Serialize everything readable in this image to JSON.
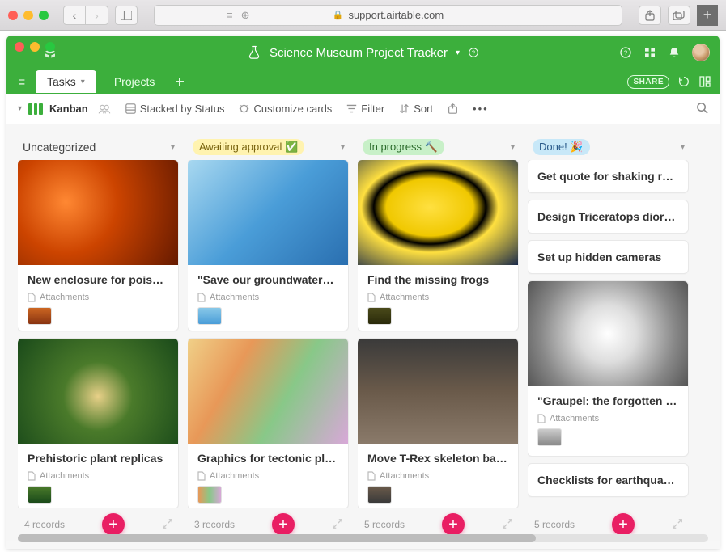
{
  "browser": {
    "url": "support.airtable.com"
  },
  "base": {
    "title": "Science Museum Project Tracker"
  },
  "tabs": {
    "active": "Tasks",
    "others": [
      "Projects"
    ]
  },
  "view": {
    "name": "Kanban",
    "stacked_by": "Stacked by Status",
    "customize": "Customize cards",
    "filter": "Filter",
    "sort": "Sort"
  },
  "share_label": "SHARE",
  "columns": [
    {
      "title": "Uncategorized",
      "pill": false,
      "footer_count": "4 records",
      "cards": [
        {
          "kind": "img",
          "img": "img-frog",
          "title": "New enclosure for poiso…",
          "attach_label": "Attachments",
          "thumb": "thumb-frog"
        },
        {
          "kind": "img",
          "img": "img-plant",
          "title": "Prehistoric plant replicas",
          "attach_label": "Attachments",
          "thumb": "thumb-plant"
        }
      ]
    },
    {
      "title": "Awaiting approval ✅",
      "pill": true,
      "pill_bg": "#fff3b0",
      "pill_fg": "#7a6510",
      "footer_count": "3 records",
      "cards": [
        {
          "kind": "img",
          "img": "img-water",
          "title": "\"Save our groundwater\" …",
          "attach_label": "Attachments",
          "thumb": "thumb-water"
        },
        {
          "kind": "img",
          "img": "img-plates",
          "title": "Graphics for tectonic pla…",
          "attach_label": "Attachments",
          "thumb": "thumb-plates"
        }
      ]
    },
    {
      "title": "In progress 🔨",
      "pill": true,
      "pill_bg": "#c8f0c8",
      "pill_fg": "#2a6a2a",
      "footer_count": "5 records",
      "cards": [
        {
          "kind": "img",
          "img": "img-yellowfrog",
          "title": "Find the missing frogs",
          "attach_label": "Attachments",
          "thumb": "thumb-yf"
        },
        {
          "kind": "img",
          "img": "img-trex",
          "title": "Move T-Rex skeleton ba…",
          "attach_label": "Attachments",
          "thumb": "thumb-trex"
        }
      ]
    },
    {
      "title": "Done! 🎉",
      "pill": true,
      "pill_bg": "#c8e8f8",
      "pill_fg": "#2a5a8a",
      "footer_count": "5 records",
      "cards": [
        {
          "kind": "simple",
          "title": "Get quote for shaking ro…"
        },
        {
          "kind": "simple",
          "title": "Design Triceratops diora…"
        },
        {
          "kind": "simple",
          "title": "Set up hidden cameras"
        },
        {
          "kind": "img",
          "img": "img-graupel",
          "title": "\"Graupel: the forgotten p…",
          "attach_label": "Attachments",
          "thumb": "thumb-gr"
        },
        {
          "kind": "simple",
          "title": "Checklists for earthquak…"
        }
      ]
    }
  ]
}
